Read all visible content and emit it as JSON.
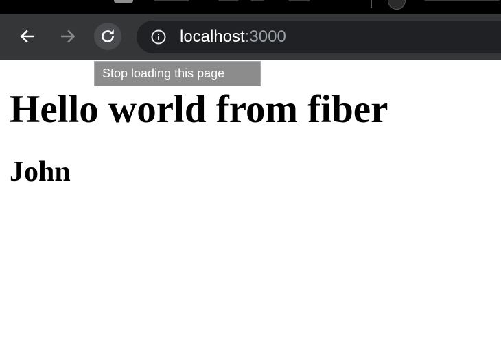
{
  "browser": {
    "url_host": "localhost",
    "url_port": ":3000",
    "tooltip": "Stop loading this page",
    "icons": [
      "back-arrow-icon",
      "forward-arrow-icon",
      "reload-icon",
      "info-icon"
    ]
  },
  "page": {
    "heading": "Hello world from fiber",
    "subheading": "John"
  },
  "colors": {
    "toolbar_bg": "#353638",
    "omnibox_bg": "#202124",
    "tooltip_bg": "#8c8c8c"
  }
}
